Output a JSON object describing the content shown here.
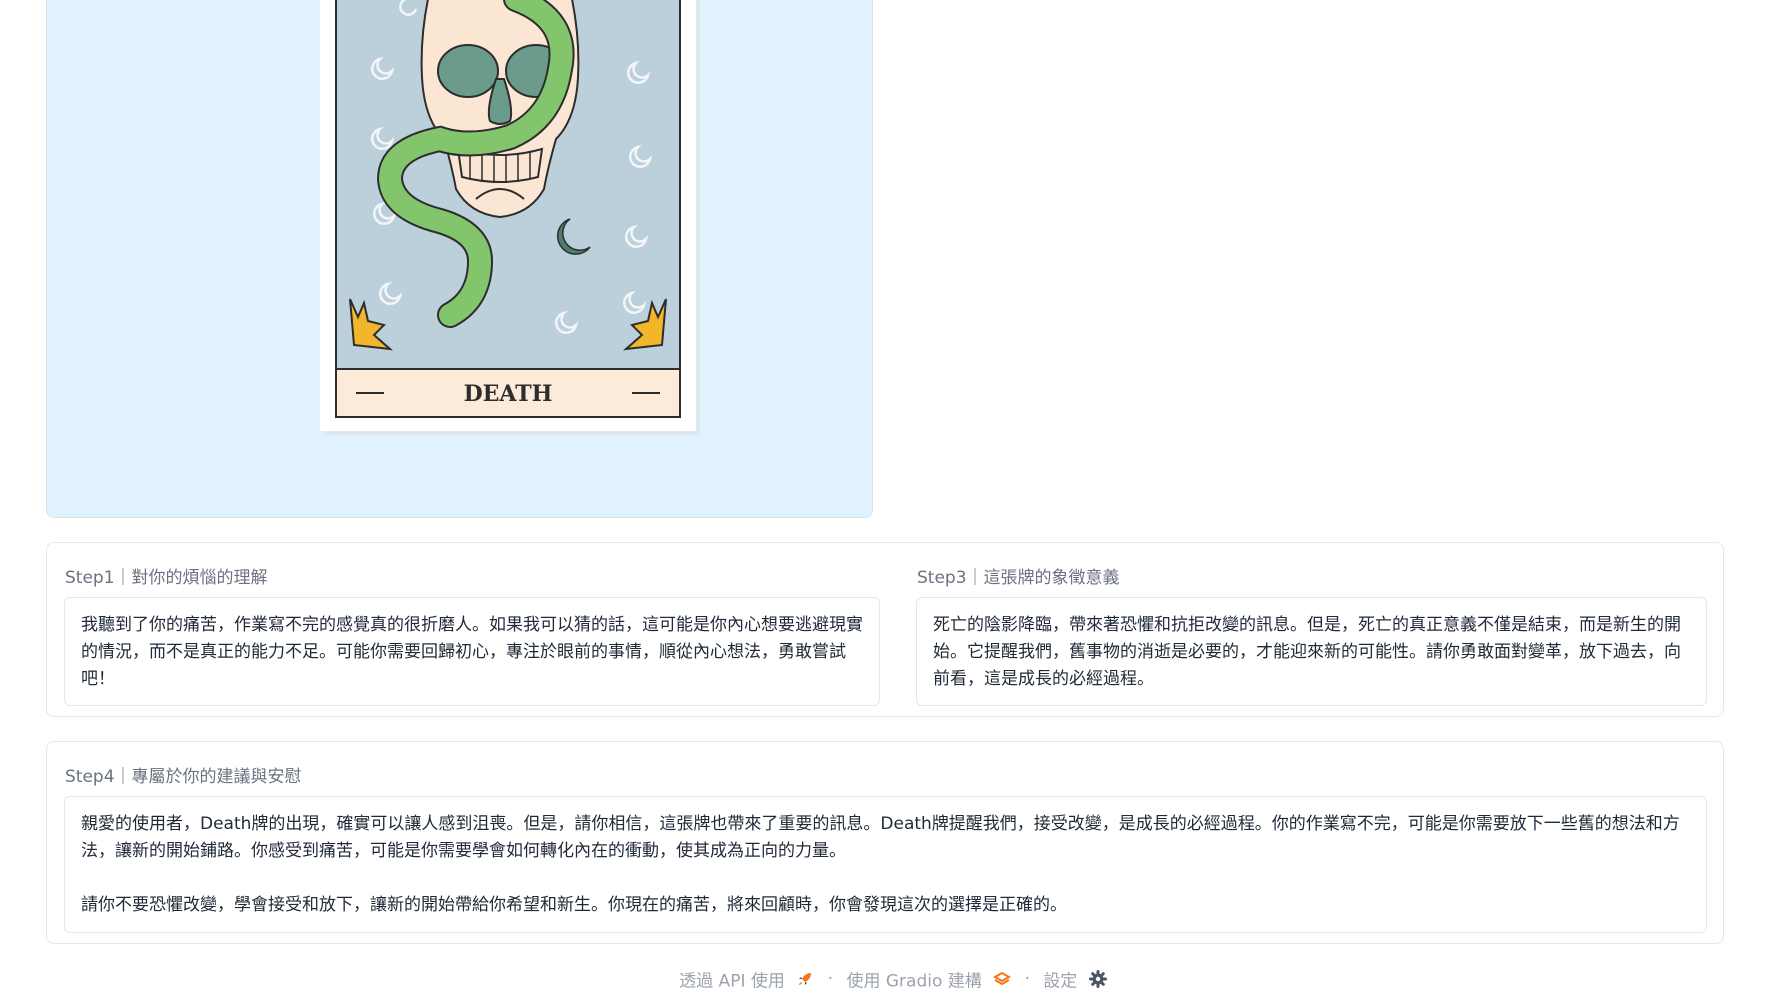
{
  "tarot_card": {
    "name": "DEATH",
    "colors": {
      "card_bg": "#bcd0db",
      "skull": "#fbe6d4",
      "snake": "#83c56d",
      "eyes": "#6b9b8a",
      "accent": "#f2b62b",
      "frame": "#fdebd9"
    }
  },
  "step1": {
    "label": "Step1｜對你的煩惱的理解",
    "text": "我聽到了你的痛苦，作業寫不完的感覺真的很折磨人。如果我可以猜的話，這可能是你內心想要逃避現實的情況，而不是真正的能力不足。可能你需要回歸初心，專注於眼前的事情，順從內心想法，勇敢嘗試吧！"
  },
  "step3": {
    "label": "Step3｜這張牌的象徵意義",
    "text": "死亡的陰影降臨，帶來著恐懼和抗拒改變的訊息。但是，死亡的真正意義不僅是結束，而是新生的開始。它提醒我們，舊事物的消逝是必要的，才能迎來新的可能性。請你勇敢面對變革，放下過去，向前看，這是成長的必經過程。"
  },
  "step4": {
    "label": "Step4｜專屬於你的建議與安慰",
    "text": "親愛的使用者，Death牌的出現，確實可以讓人感到沮喪。但是，請你相信，這張牌也帶來了重要的訊息。Death牌提醒我們，接受改變，是成長的必經過程。你的作業寫不完，可能是你需要放下一些舊的想法和方法，讓新的開始鋪路。你感受到痛苦，可能是你需要學會如何轉化內在的衝動，使其成為正向的力量。\n\n請你不要恐懼改變，學會接受和放下，讓新的開始帶給你希望和新生。你現在的痛苦，將來回顧時，你會發現這次的選擇是正確的。"
  },
  "footer": {
    "api_label": "透過 API 使用",
    "api_icon": "rocket-icon",
    "separator": "·",
    "gradio_label": "使用 Gradio 建構",
    "gradio_icon": "gradio-logo-icon",
    "settings_label": "設定",
    "settings_icon": "gear-icon"
  }
}
